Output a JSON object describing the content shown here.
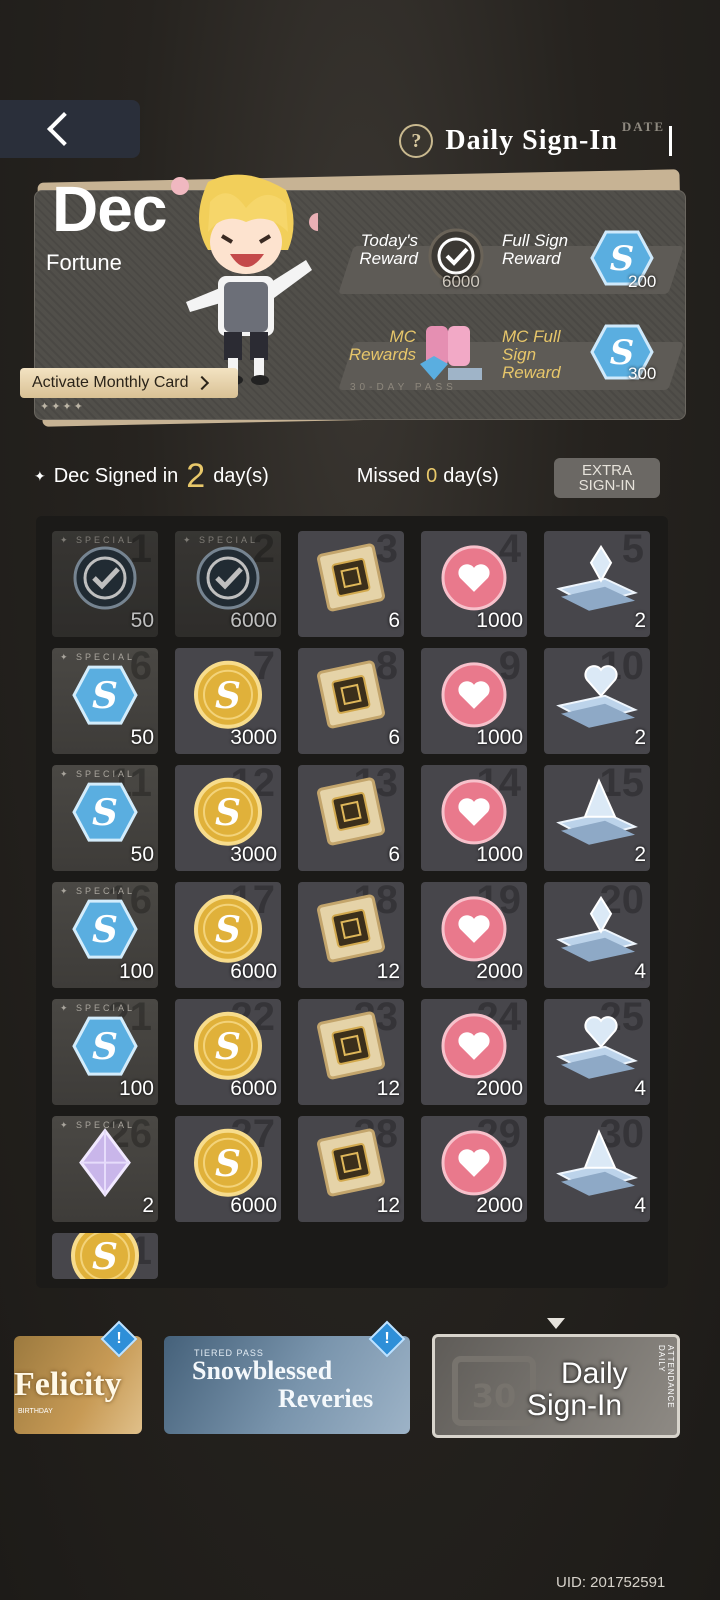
{
  "header": {
    "title": "Daily Sign-In",
    "title_suffix": "DATE",
    "help_icon": "question-circle-icon",
    "back_icon": "chevron-left-icon"
  },
  "banner": {
    "month": "Dec",
    "subtitle": "Fortune",
    "activate_label": "Activate Monthly Card",
    "stars": "✦✦✦✦",
    "todays_reward_label": [
      "Today's",
      "Reward"
    ],
    "todays_reward_value": "6000",
    "full_sign_label": [
      "Full Sign",
      "Reward"
    ],
    "full_sign_value": "200",
    "mc_rewards_label": [
      "MC",
      "Rewards"
    ],
    "mc_pass_label": "30-DAY PASS",
    "mc_full_label": [
      "MC Full",
      "Sign",
      "Reward"
    ],
    "mc_full_value": "300"
  },
  "stats": {
    "signed_prefix": "Dec Signed in",
    "signed_count": "2",
    "signed_suffix": "day(s)",
    "missed_prefix": "Missed",
    "missed_count": "0",
    "missed_suffix": "day(s)",
    "extra_button": [
      "EXTRA",
      "SIGN-IN"
    ]
  },
  "calendar": [
    {
      "day": "1",
      "item": "check",
      "amount": "50",
      "special": true,
      "signed": true
    },
    {
      "day": "2",
      "item": "check",
      "amount": "6000",
      "special": true,
      "signed": true
    },
    {
      "day": "3",
      "item": "chip",
      "amount": "6",
      "special": false,
      "signed": false
    },
    {
      "day": "4",
      "item": "heart",
      "amount": "1000",
      "special": false,
      "signed": false
    },
    {
      "day": "5",
      "item": "diamond-stand",
      "amount": "2",
      "special": false,
      "signed": false
    },
    {
      "day": "6",
      "item": "blue-coin",
      "amount": "50",
      "special": true,
      "signed": false
    },
    {
      "day": "7",
      "item": "gold-coin",
      "amount": "3000",
      "special": false,
      "signed": false
    },
    {
      "day": "8",
      "item": "chip",
      "amount": "6",
      "special": false,
      "signed": false
    },
    {
      "day": "9",
      "item": "heart",
      "amount": "1000",
      "special": false,
      "signed": false
    },
    {
      "day": "10",
      "item": "heart-stand",
      "amount": "2",
      "special": false,
      "signed": false
    },
    {
      "day": "11",
      "item": "blue-coin",
      "amount": "50",
      "special": true,
      "signed": false
    },
    {
      "day": "12",
      "item": "gold-coin",
      "amount": "3000",
      "special": false,
      "signed": false
    },
    {
      "day": "13",
      "item": "chip",
      "amount": "6",
      "special": false,
      "signed": false
    },
    {
      "day": "14",
      "item": "heart",
      "amount": "1000",
      "special": false,
      "signed": false
    },
    {
      "day": "15",
      "item": "pyramid-stand",
      "amount": "2",
      "special": false,
      "signed": false
    },
    {
      "day": "16",
      "item": "blue-coin",
      "amount": "100",
      "special": true,
      "signed": false
    },
    {
      "day": "17",
      "item": "gold-coin",
      "amount": "6000",
      "special": false,
      "signed": false
    },
    {
      "day": "18",
      "item": "chip",
      "amount": "12",
      "special": false,
      "signed": false
    },
    {
      "day": "19",
      "item": "heart",
      "amount": "2000",
      "special": false,
      "signed": false
    },
    {
      "day": "20",
      "item": "diamond-stand",
      "amount": "4",
      "special": false,
      "signed": false
    },
    {
      "day": "21",
      "item": "blue-coin",
      "amount": "100",
      "special": true,
      "signed": false
    },
    {
      "day": "22",
      "item": "gold-coin",
      "amount": "6000",
      "special": false,
      "signed": false
    },
    {
      "day": "23",
      "item": "chip",
      "amount": "12",
      "special": false,
      "signed": false
    },
    {
      "day": "24",
      "item": "heart",
      "amount": "2000",
      "special": false,
      "signed": false
    },
    {
      "day": "25",
      "item": "heart-stand",
      "amount": "4",
      "special": false,
      "signed": false
    },
    {
      "day": "26",
      "item": "crystal",
      "amount": "2",
      "special": true,
      "signed": false
    },
    {
      "day": "27",
      "item": "gold-coin",
      "amount": "6000",
      "special": false,
      "signed": false
    },
    {
      "day": "28",
      "item": "chip",
      "amount": "12",
      "special": false,
      "signed": false
    },
    {
      "day": "29",
      "item": "heart",
      "amount": "2000",
      "special": false,
      "signed": false
    },
    {
      "day": "30",
      "item": "pyramid-stand",
      "amount": "4",
      "special": false,
      "signed": false
    },
    {
      "day": "31",
      "item": "gold-coin",
      "amount": "",
      "special": false,
      "signed": false
    }
  ],
  "special_tag": "SPECIAL",
  "tabs": {
    "felicity": {
      "title": "Felicity",
      "sub": "BIRTHDAY"
    },
    "snow": {
      "kicker": "TIERED PASS",
      "title_1": "Snowblessed",
      "title_2": "Reveries"
    },
    "daily": {
      "title_1": "Daily",
      "title_2": "Sign-In",
      "side": "ATTENDANCE DAILY"
    },
    "badge_symbol": "!"
  },
  "uid": "UID: 201752591",
  "colors": {
    "gold": "#e8c86a",
    "heart": "#e9798c",
    "blue_coin": "#5aaee0",
    "gold_coin": "#e0b13a"
  }
}
